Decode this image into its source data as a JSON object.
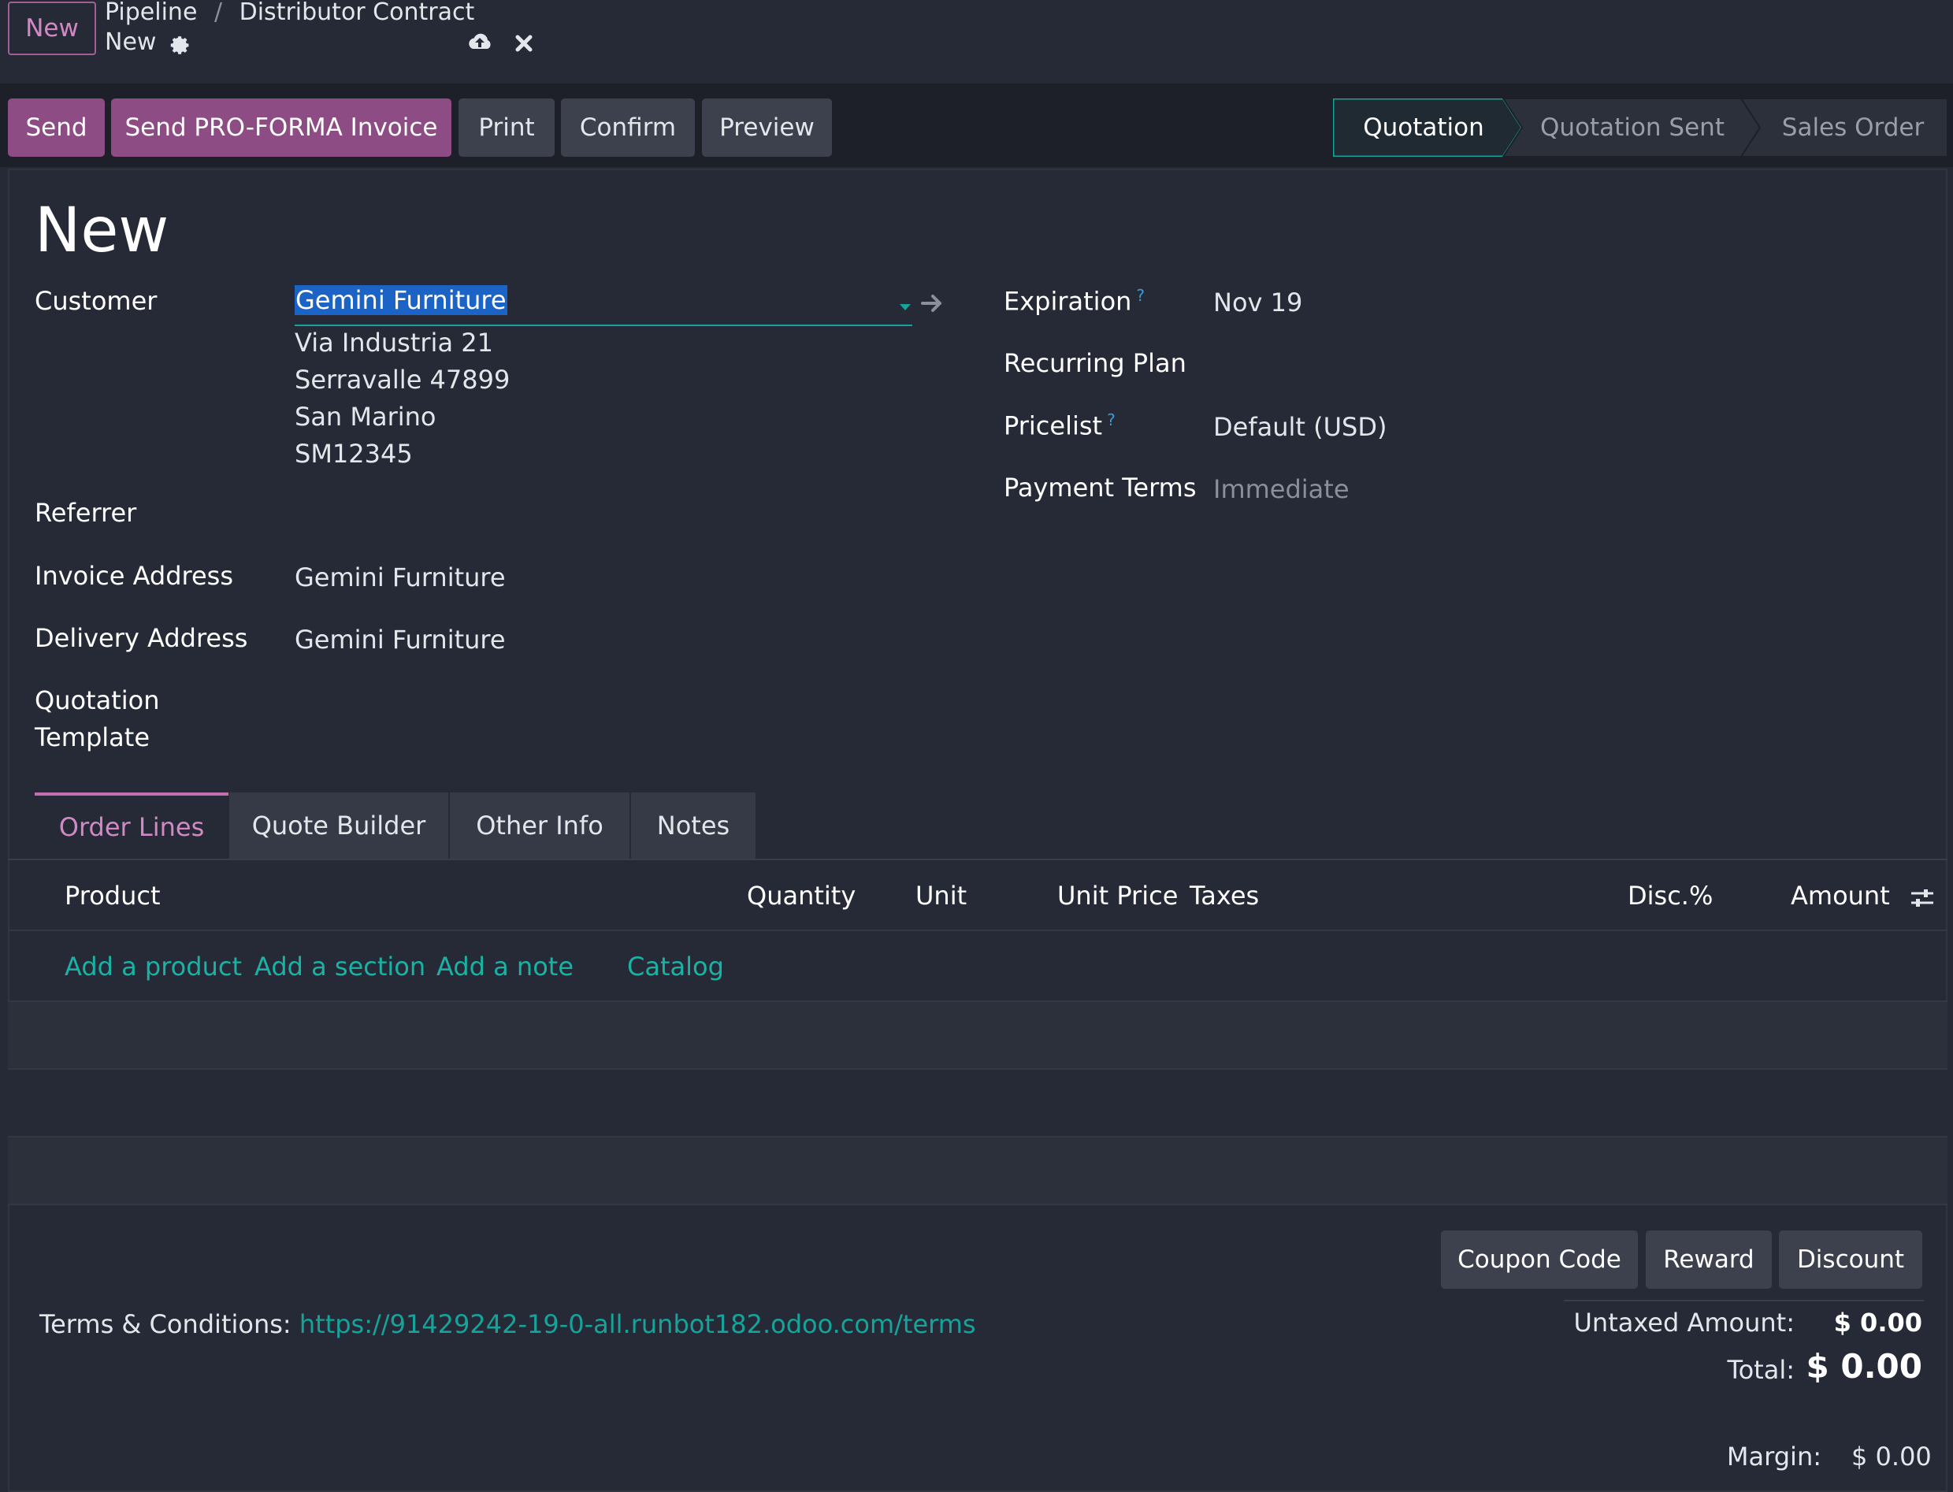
{
  "header": {
    "new_button": "New",
    "breadcrumb_parent": "Pipeline",
    "breadcrumb_sep": "/",
    "breadcrumb_current": "Distributor Contract",
    "record_name": "New",
    "icons": [
      "gear-icon",
      "cloud-upload-icon",
      "close-icon"
    ]
  },
  "actions": {
    "send": "Send",
    "send_proforma": "Send PRO-FORMA Invoice",
    "print": "Print",
    "confirm": "Confirm",
    "preview": "Preview"
  },
  "status": {
    "stages": [
      "Quotation",
      "Quotation Sent",
      "Sales Order"
    ],
    "active": "Quotation"
  },
  "form": {
    "title": "New",
    "customer_label": "Customer",
    "customer_value": "Gemini Furniture",
    "customer_address": [
      "Via Industria 21",
      "Serravalle 47899",
      "San Marino",
      "SM12345"
    ],
    "referrer_label": "Referrer",
    "invoice_address_label": "Invoice Address",
    "invoice_address_value": "Gemini Furniture",
    "delivery_address_label": "Delivery Address",
    "delivery_address_value": "Gemini Furniture",
    "quotation_template_label_1": "Quotation",
    "quotation_template_label_2": "Template",
    "expiration_label": "Expiration",
    "expiration_value": "Nov 19",
    "recurring_plan_label": "Recurring Plan",
    "pricelist_label": "Pricelist",
    "pricelist_value": "Default (USD)",
    "payment_terms_label": "Payment Terms",
    "payment_terms_placeholder": "Immediate",
    "help_mark": "?"
  },
  "tabs": [
    "Order Lines",
    "Quote Builder",
    "Other Info",
    "Notes"
  ],
  "order_lines": {
    "columns": [
      "Product",
      "Quantity",
      "Unit",
      "Unit Price",
      "Taxes",
      "Disc.%",
      "Amount"
    ],
    "add_product": "Add a product",
    "add_section": "Add a section",
    "add_note": "Add a note",
    "catalog": "Catalog"
  },
  "footer_buttons": {
    "coupon": "Coupon Code",
    "reward": "Reward",
    "discount": "Discount"
  },
  "terms": {
    "label": "Terms & Conditions:",
    "url": "https://91429242-19-0-all.runbot182.odoo.com/terms"
  },
  "totals": {
    "untaxed_label": "Untaxed Amount:",
    "untaxed_value": "$ 0.00",
    "total_label": "Total:",
    "total_value": "$ 0.00",
    "margin_label": "Margin:",
    "margin_value": "$ 0.00"
  },
  "colors": {
    "background": "#262a36",
    "primary": "#8e4c84",
    "accent": "#16a39a",
    "link": "#19b3a5"
  }
}
